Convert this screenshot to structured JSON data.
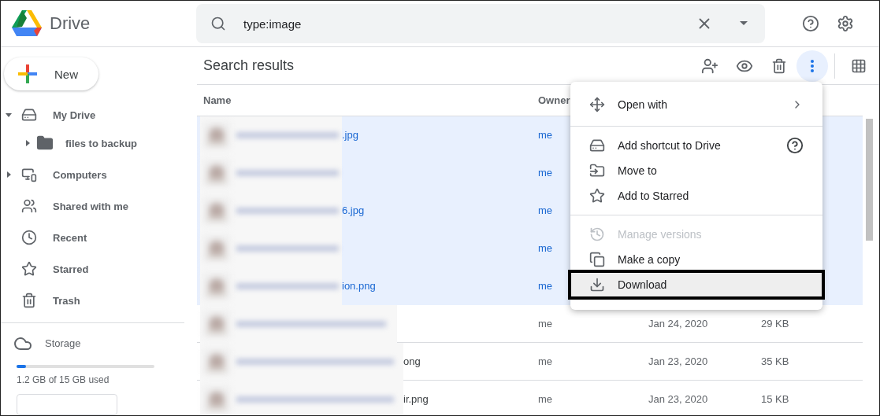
{
  "app": {
    "name": "Drive"
  },
  "search": {
    "value": "type:image"
  },
  "new_button": {
    "label": "New"
  },
  "sidebar": {
    "items": [
      {
        "label": "My Drive",
        "expanded": true,
        "children": [
          {
            "label": "files to backup",
            "expanded": false
          }
        ]
      },
      {
        "label": "Computers",
        "expanded": false
      },
      {
        "label": "Shared with me"
      },
      {
        "label": "Recent"
      },
      {
        "label": "Starred"
      },
      {
        "label": "Trash"
      }
    ]
  },
  "storage": {
    "label": "Storage",
    "level": 0.07,
    "usage": "1.2 GB of 15 GB used"
  },
  "results": {
    "title": "Search results",
    "more_active": true,
    "columns": [
      "Name",
      "Owner"
    ],
    "rows": [
      {
        "name": ".jpg",
        "owner": "me",
        "selected": true
      },
      {
        "owner": "me",
        "selected": true
      },
      {
        "name": "6.jpg",
        "owner": "me",
        "selected": true
      },
      {
        "owner": "me",
        "selected": true
      },
      {
        "name": "ion.png",
        "owner": "me",
        "selected": true
      },
      {
        "owner": "me",
        "modified": "Jan 24, 2020",
        "size": "29 KB",
        "selected": false
      },
      {
        "name": "ong",
        "owner": "me",
        "modified": "Jan 23, 2020",
        "size": "35 KB",
        "selected": false
      },
      {
        "name": "ir.png",
        "owner": "me",
        "modified": "Jan 23, 2020",
        "size": "15 KB",
        "selected": false
      }
    ]
  },
  "menu": {
    "items": [
      {
        "kind": "item",
        "label": "Open with",
        "submenu": true,
        "disabled": false,
        "selected": false
      },
      {
        "kind": "divider"
      },
      {
        "kind": "item",
        "label": "Add shortcut to Drive",
        "help": true,
        "disabled": false,
        "selected": false
      },
      {
        "kind": "item",
        "label": "Move to",
        "disabled": false,
        "selected": false
      },
      {
        "kind": "item",
        "label": "Add to Starred",
        "disabled": false,
        "selected": false
      },
      {
        "kind": "divider"
      },
      {
        "kind": "item",
        "label": "Manage versions",
        "disabled": true,
        "selected": false
      },
      {
        "kind": "item",
        "label": "Make a copy",
        "disabled": false,
        "selected": false
      },
      {
        "kind": "item",
        "label": "Download",
        "disabled": false,
        "selected": true,
        "outlined": true
      }
    ]
  }
}
